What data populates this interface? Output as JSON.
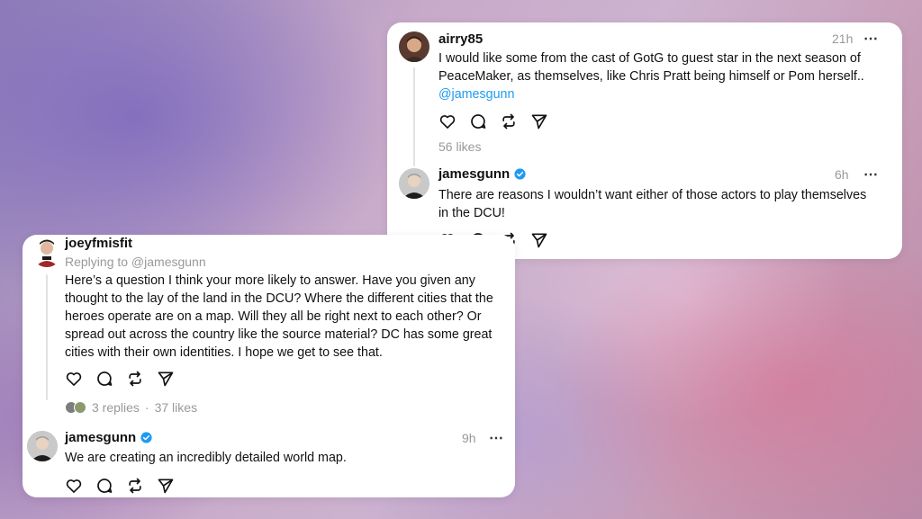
{
  "card_top": {
    "post1": {
      "username": "airry85",
      "time": "21h",
      "text_lines": [
        "I would like some from the cast of GotG to guest star in the next season of",
        "PeaceMaker, as themselves, like Chris Pratt being himself or Pom herself.."
      ],
      "mention": "@jamesgunn",
      "likes": "56 likes"
    },
    "post2": {
      "username": "jamesgunn",
      "time": "6h",
      "text_lines": [
        "There are reasons I wouldn’t want either of those actors to play themselves",
        "in the DCU!"
      ]
    }
  },
  "card_bottom": {
    "post1": {
      "username": "joeyfmisfit",
      "replying_to": "Replying to @jamesgunn",
      "text_lines": [
        "Here’s a question I think your more likely to answer. Have you given any",
        "thought to the lay of the land in the DCU? Where the different cities that the",
        "heroes operate are on a map. Will they all be right next to each other? Or",
        "spread out across the country like the source material? DC has some great",
        "cities with their own identities. I hope we get to see that."
      ],
      "replies": "3 replies",
      "separator": "·",
      "likes": "37 likes"
    },
    "post2": {
      "username": "jamesgunn",
      "time": "9h",
      "text": "We are creating an incredibly detailed world map."
    }
  },
  "icons": {
    "more": "⋯",
    "like": "heart-icon",
    "reply": "comment-icon",
    "repost": "repost-icon",
    "share": "send-icon",
    "verified": "verified-badge-icon"
  },
  "colors": {
    "mention": "#1d9bf0",
    "verified": "#1d9bf0",
    "muted": "#999999"
  }
}
